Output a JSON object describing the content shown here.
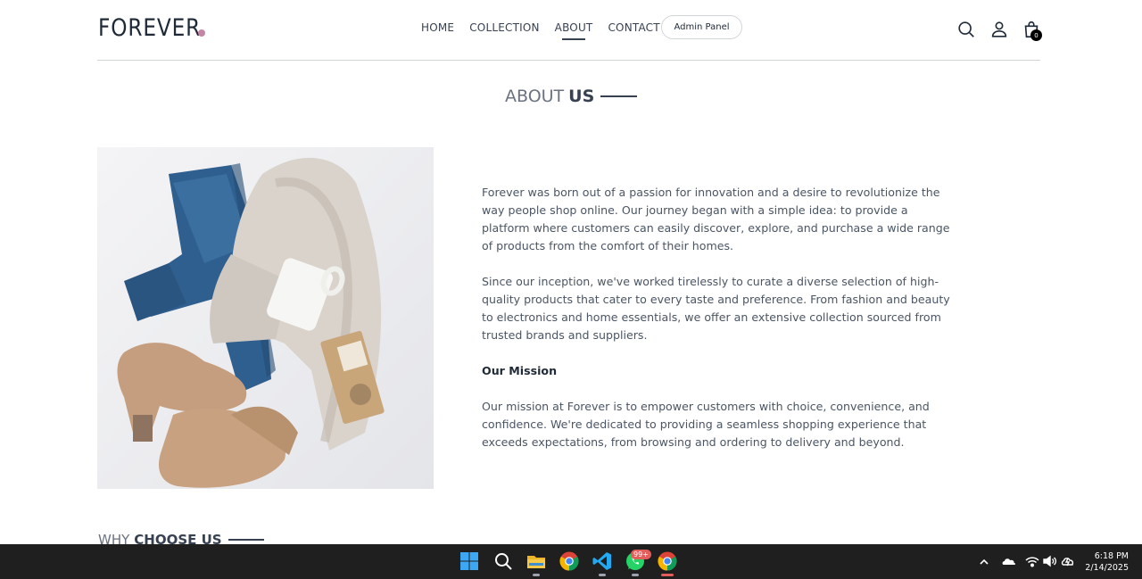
{
  "navbar": {
    "logo": "FOREVER",
    "links": [
      "HOME",
      "COLLECTION",
      "ABOUT",
      "CONTACT"
    ],
    "active_link": "ABOUT",
    "admin_label": "Admin Panel",
    "cart_count": "0"
  },
  "about": {
    "title_light": "ABOUT",
    "title_bold": "US",
    "paragraph_1": "Forever was born out of a passion for innovation and a desire to revolutionize the way people shop online. Our journey began with a simple idea: to provide a platform where customers can easily discover, explore, and purchase a wide range of products from the comfort of their homes.",
    "paragraph_2": "Since our inception, we've worked tirelessly to curate a diverse selection of high-quality products that cater to every taste and preference. From fashion and beauty to electronics and home essentials, we offer an extensive collection sourced from trusted brands and suppliers.",
    "mission_heading": "Our Mission",
    "mission_text": "Our mission at Forever is to empower customers with choice, convenience, and confidence. We're dedicated to providing a seamless shopping experience that exceeds expectations, from browsing and ordering to delivery and beyond."
  },
  "why": {
    "title_light": "WHY",
    "title_bold": "CHOOSE US"
  },
  "taskbar": {
    "whatsapp_badge": "99+",
    "time": "6:18 PM",
    "date": "2/14/2025"
  },
  "colors": {
    "accent_dot": "#c586a5",
    "taskbar": "#1f1f1f"
  }
}
